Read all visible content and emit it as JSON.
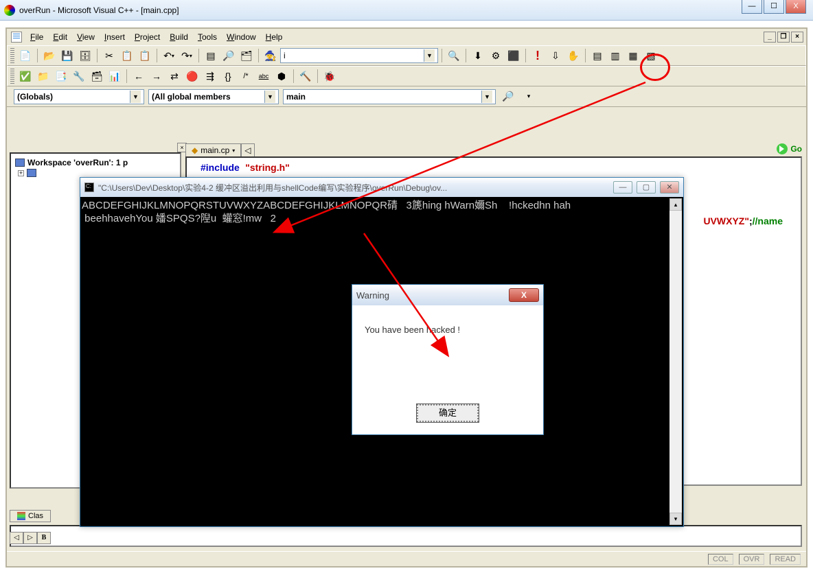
{
  "titlebar": {
    "title": "overRun - Microsoft Visual C++ - [main.cpp]"
  },
  "menu": {
    "file": "File",
    "edit": "Edit",
    "view": "View",
    "insert": "Insert",
    "project": "Project",
    "build": "Build",
    "tools": "Tools",
    "window": "Window",
    "help": "Help"
  },
  "toolbar1": {
    "combo_value": "i"
  },
  "scope": {
    "globals": "(Globals)",
    "members": "(All global members",
    "func": "main"
  },
  "file_tab": {
    "name": "main.cp"
  },
  "workspace": {
    "root": "Workspace 'overRun': 1 p"
  },
  "code": {
    "include_kw": "#include",
    "include_str": "\"string.h\"",
    "frag_right": "UVWXYZ\";//name"
  },
  "bottom_tab": {
    "label": "Clas"
  },
  "out_nav": {
    "b": "B"
  },
  "status": {
    "col": "COL",
    "ovr": "OVR",
    "read": "READ"
  },
  "console": {
    "title": "\"C:\\Users\\Dev\\Desktop\\实验4-2 缓冲区溢出利用与shellCode编写\\实验程序\\overRun\\Debug\\ov...",
    "line1": "ABCDEFGHIJKLMNOPQRSTUVWXYZABCDEFGHIJKLMNOPQR碃   3篪hing hWarn嬭Sh    !hckedhn hah",
    "line2": " beehhavehYou 嬏SPQS?隉u  蠸窓!mw   2"
  },
  "warning": {
    "title": "Warning",
    "message": "You have been hacked   !",
    "ok": "确定"
  },
  "go": {
    "label": "Go"
  },
  "icons": {
    "min": "—",
    "max": "☐",
    "close": "X",
    "restore": "🗗",
    "mdi_close": "x",
    "new": "📄",
    "open": "📂",
    "save": "💾",
    "saveall": "🗄",
    "cut": "✂",
    "copy": "📋",
    "paste": "📋",
    "undo": "↶",
    "redo": "↷",
    "find": "🔍",
    "findf": "🔎",
    "replace": "🗂",
    "wiz": "🧙",
    "compile": "⚙",
    "dbg_go": "⬇",
    "dbg_stop": "⬛",
    "dbg_break": "🛑",
    "exclaim": "!",
    "step": "⇩",
    "hand": "✋",
    "wnd1": "▤",
    "wnd2": "▥",
    "wnd3": "▦",
    "wnd4": "▧",
    "tb2a": "✅",
    "tb2b": "📁",
    "tb2c": "📑",
    "tb2d": "🔧",
    "tb2e": "🗃",
    "tb2f": "📊",
    "lar": "←",
    "rar": "→",
    "tog": "⇄",
    "brk": "🔴",
    "bm": "⇶",
    "fn": "{}",
    "hash": "/*",
    "abc": "abc",
    "hex": "⬢",
    "bld": "🔨",
    "bug": "🐞",
    "arrow_down": "▾",
    "arrow_dd": "▼",
    "tri_lt": "◁",
    "tri_rt": "▷",
    "tri_up": "▴",
    "tri_dn": "▾",
    "x": "✕"
  }
}
